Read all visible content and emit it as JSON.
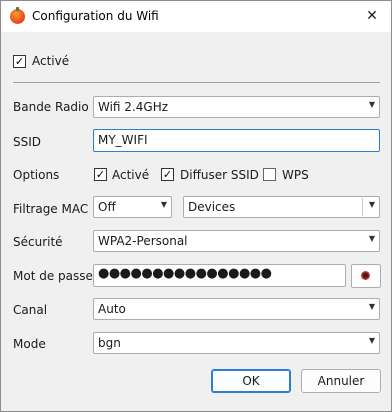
{
  "window": {
    "title": "Configuration du Wifi",
    "close_symbol": "✕"
  },
  "enabled": {
    "label": "Activé",
    "checked": true,
    "mark": "✓"
  },
  "fields": {
    "band": {
      "label": "Bande Radio",
      "value": "Wifi 2.4GHz"
    },
    "ssid": {
      "label": "SSID",
      "value": "MY_WIFI"
    },
    "options": {
      "label": "Options",
      "items": [
        {
          "label": "Activé",
          "checked": true,
          "mark": "✓"
        },
        {
          "label": "Diffuser SSID",
          "checked": true,
          "mark": "✓"
        },
        {
          "label": "WPS",
          "checked": false,
          "mark": ""
        }
      ]
    },
    "mac_filter": {
      "label": "Filtrage MAC",
      "mode": "Off",
      "list": "Devices"
    },
    "security": {
      "label": "Sécurité",
      "value": "WPA2-Personal"
    },
    "password": {
      "label": "Mot de passe",
      "value": "●●●●●●●●●●●●●●●●"
    },
    "channel": {
      "label": "Canal",
      "value": "Auto"
    },
    "mode": {
      "label": "Mode",
      "value": "bgn"
    }
  },
  "buttons": {
    "ok": "OK",
    "cancel": "Annuler"
  },
  "combo_arrow": "▼"
}
